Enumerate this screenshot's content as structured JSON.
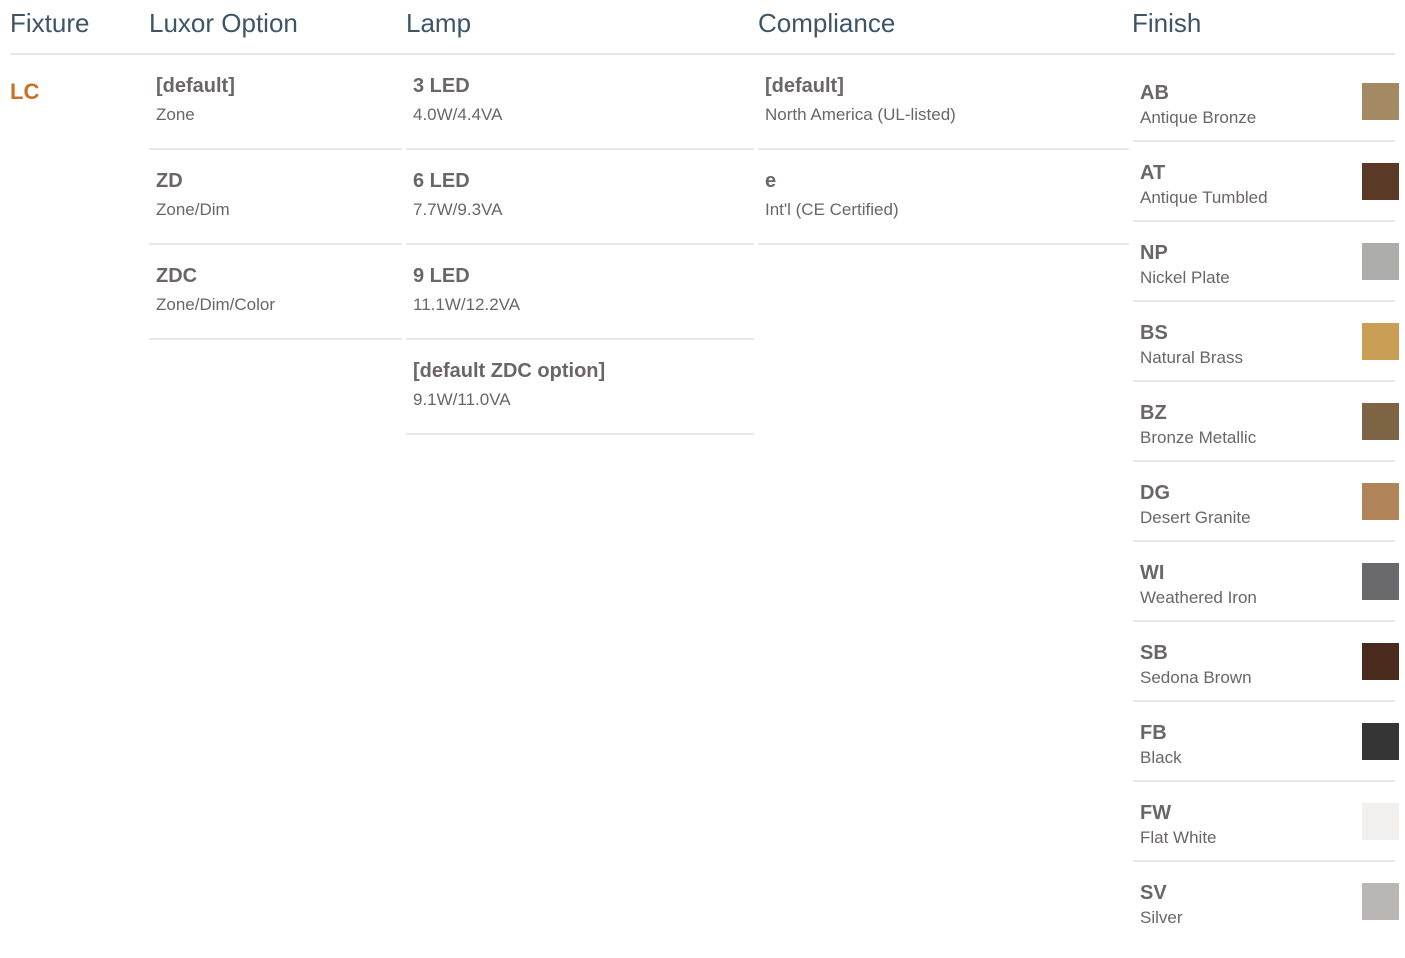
{
  "headers": {
    "fixture": "Fixture",
    "luxor_option": "Luxor Option",
    "lamp": "Lamp",
    "compliance": "Compliance",
    "finish": "Finish"
  },
  "fixture": {
    "code": "LC"
  },
  "luxor_options": [
    {
      "code": "[default]",
      "desc": "Zone"
    },
    {
      "code": "ZD",
      "desc": "Zone/Dim"
    },
    {
      "code": "ZDC",
      "desc": "Zone/Dim/Color"
    }
  ],
  "lamps": [
    {
      "code": "3 LED",
      "desc": "4.0W/4.4VA"
    },
    {
      "code": "6 LED",
      "desc": "7.7W/9.3VA"
    },
    {
      "code": "9 LED",
      "desc": "11.1W/12.2VA"
    },
    {
      "code": "[default ZDC option]",
      "desc": "9.1W/11.0VA"
    }
  ],
  "compliance": [
    {
      "code": "[default]",
      "desc": "North America (UL-listed)"
    },
    {
      "code": "e",
      "desc": "Int'l (CE Certified)"
    }
  ],
  "finishes": [
    {
      "code": "AB",
      "desc": "Antique Bronze",
      "color": "#a48a62"
    },
    {
      "code": "AT",
      "desc": "Antique Tumbled",
      "color": "#5a3a26"
    },
    {
      "code": "NP",
      "desc": "Nickel Plate",
      "color": "#adadab"
    },
    {
      "code": "BS",
      "desc": "Natural Brass",
      "color": "#c99e55"
    },
    {
      "code": "BZ",
      "desc": "Bronze Metallic",
      "color": "#7c6444"
    },
    {
      "code": "DG",
      "desc": "Desert Granite",
      "color": "#b08458"
    },
    {
      "code": "WI",
      "desc": "Weathered Iron",
      "color": "#6a6a6c"
    },
    {
      "code": "SB",
      "desc": "Sedona Brown",
      "color": "#4a2a1c"
    },
    {
      "code": "FB",
      "desc": "Black",
      "color": "#363536"
    },
    {
      "code": "FW",
      "desc": "Flat White",
      "color": "#f1f0ef"
    },
    {
      "code": "SV",
      "desc": "Silver",
      "color": "#b9b6b3"
    }
  ]
}
